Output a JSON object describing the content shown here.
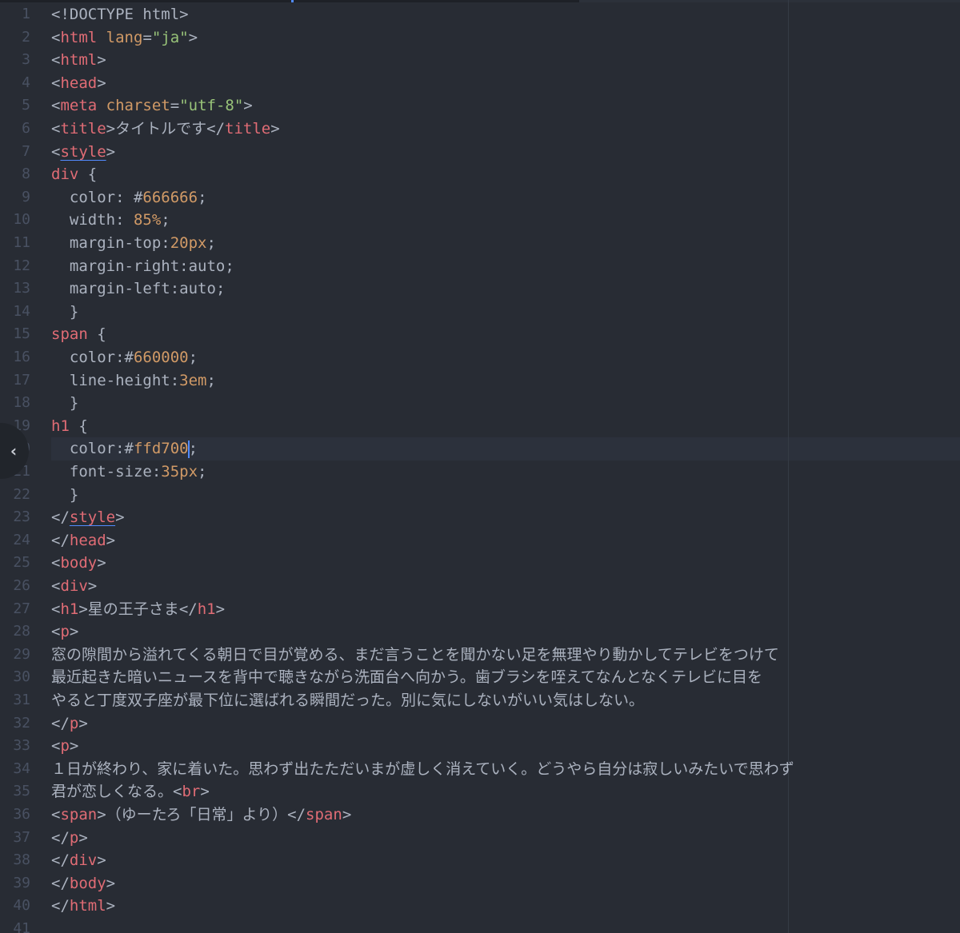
{
  "editor": {
    "fold_icon": "chevron-left-icon",
    "active_line": 20,
    "lines": [
      {
        "n": "1",
        "text": "<!DOCTYPE html>"
      },
      {
        "n": "2",
        "text": "<html lang=\"ja\">"
      },
      {
        "n": "3",
        "text": "<html>"
      },
      {
        "n": "4",
        "text": "<head>"
      },
      {
        "n": "5",
        "text": "<meta charset=\"utf-8\">"
      },
      {
        "n": "6",
        "text": "<title>タイトルです</title>"
      },
      {
        "n": "7",
        "text": "<style>"
      },
      {
        "n": "8",
        "text": "div {"
      },
      {
        "n": "9",
        "text": "  color: #666666;"
      },
      {
        "n": "10",
        "text": "  width: 85%;"
      },
      {
        "n": "11",
        "text": "  margin-top:20px;"
      },
      {
        "n": "12",
        "text": "  margin-right:auto;"
      },
      {
        "n": "13",
        "text": "  margin-left:auto;"
      },
      {
        "n": "14",
        "text": "  }"
      },
      {
        "n": "15",
        "text": "span {"
      },
      {
        "n": "16",
        "text": "  color:#660000;"
      },
      {
        "n": "17",
        "text": "  line-height:3em;"
      },
      {
        "n": "18",
        "text": "  }"
      },
      {
        "n": "19",
        "text": "h1 {"
      },
      {
        "n": "20",
        "text": "  color:#ffd700;"
      },
      {
        "n": "21",
        "text": "  font-size:35px;"
      },
      {
        "n": "22",
        "text": "  }"
      },
      {
        "n": "23",
        "text": "</style>"
      },
      {
        "n": "24",
        "text": "</head>"
      },
      {
        "n": "25",
        "text": "<body>"
      },
      {
        "n": "26",
        "text": "<div>"
      },
      {
        "n": "27",
        "text": "<h1>星の王子さま</h1>"
      },
      {
        "n": "28",
        "text": "<p>"
      },
      {
        "n": "29",
        "text": "窓の隙間から溢れてくる朝日で目が覚める、まだ言うことを聞かない足を無理やり動かしてテレビをつけて"
      },
      {
        "n": "30",
        "text": "最近起きた暗いニュースを背中で聴きながら洗面台へ向かう。歯ブラシを咥えてなんとなくテレビに目を"
      },
      {
        "n": "31",
        "text": "やると丁度双子座が最下位に選ばれる瞬間だった。別に気にしないがいい気はしない。"
      },
      {
        "n": "32",
        "text": "</p>"
      },
      {
        "n": "33",
        "text": "<p>"
      },
      {
        "n": "34",
        "text": "１日が終わり、家に着いた。思わず出たただいまが虚しく消えていく。どうやら自分は寂しいみたいで思わず"
      },
      {
        "n": "35",
        "text": "君が恋しくなる。<br>"
      },
      {
        "n": "36",
        "text": "<span>（ゆーたろ「日常」より）</span>"
      },
      {
        "n": "37",
        "text": "</p>"
      },
      {
        "n": "38",
        "text": "</div>"
      },
      {
        "n": "39",
        "text": "</body>"
      },
      {
        "n": "40",
        "text": "</html>"
      },
      {
        "n": "41",
        "text": ""
      }
    ]
  }
}
